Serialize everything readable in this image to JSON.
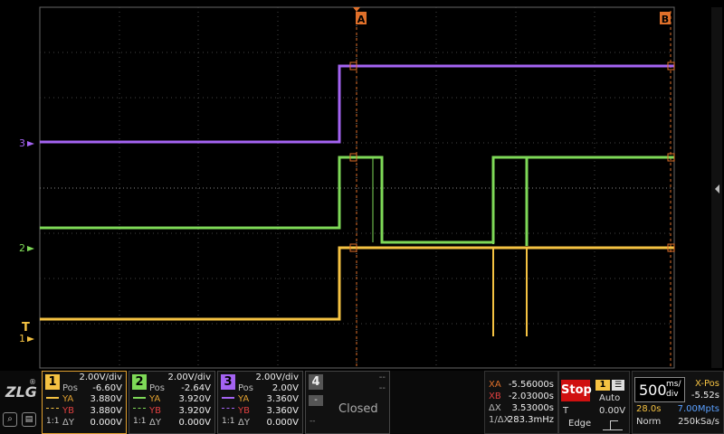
{
  "cursors": {
    "a_label": "A",
    "b_label": "B"
  },
  "markers": {
    "ch3": "3",
    "ch2": "2",
    "ch1": "1",
    "trigger": "T"
  },
  "colors": {
    "ch1": "#f5c242",
    "ch2": "#7ed957",
    "ch3": "#a463f2",
    "grid": "#555555",
    "cursor": "#e0702a",
    "stop": "#d01010"
  },
  "channels": [
    {
      "num": "1",
      "scale": "2.00V/div",
      "pos_label": "Pos",
      "pos": "-6.60V",
      "ya_label": "YA",
      "ya": "3.880V",
      "yb_label": "YB",
      "yb": "3.880V",
      "dy_label": "ΔY",
      "dy": "0.000V",
      "ratio": "1:1"
    },
    {
      "num": "2",
      "scale": "2.00V/div",
      "pos_label": "Pos",
      "pos": "-2.64V",
      "ya_label": "YA",
      "ya": "3.920V",
      "yb_label": "YB",
      "yb": "3.920V",
      "dy_label": "ΔY",
      "dy": "0.000V",
      "ratio": "1:1"
    },
    {
      "num": "3",
      "scale": "2.00V/div",
      "pos_label": "Pos",
      "pos": "2.00V",
      "ya_label": "YA",
      "ya": "3.360V",
      "yb_label": "YB",
      "yb": "3.360V",
      "dy_label": "ΔY",
      "dy": "0.000V",
      "ratio": "1:1"
    },
    {
      "num": "4",
      "scale": "--",
      "pos": "--",
      "ya": "--",
      "yb": "--",
      "dy": "--",
      "status": "Closed",
      "minus": "-"
    }
  ],
  "measure": {
    "xa_label": "XA",
    "xa": "-5.56000s",
    "xb_label": "XB",
    "xb": "-2.03000s",
    "dx_label": "ΔX",
    "dx": "3.53000s",
    "inv_label": "1/ΔX",
    "inv": "283.3mHz"
  },
  "trigger": {
    "state": "Stop",
    "source": "1",
    "mode": "Auto",
    "t_label": "T",
    "level": "0.00V",
    "type": "Edge"
  },
  "timebase": {
    "scale": "500",
    "unit_top": "ms/",
    "unit_bottom": "div",
    "xpos_label": "X-Pos",
    "xpos": "-5.52s",
    "length": "28.0s",
    "depth": "7.00Mpts",
    "acq_mode": "Norm",
    "rate": "250kSa/s"
  },
  "logo": "ZLG"
}
